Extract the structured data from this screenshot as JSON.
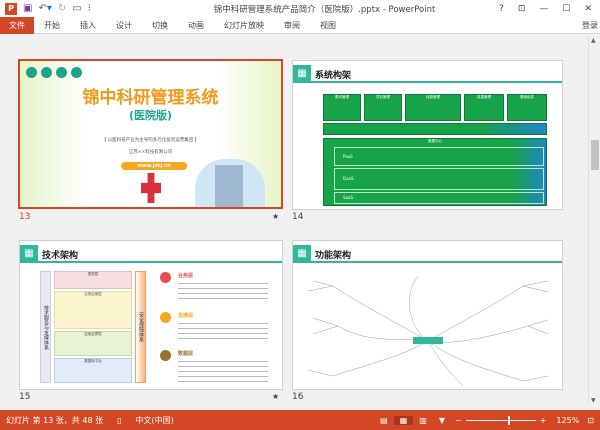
{
  "window": {
    "title": "锦中科研管理系统产品简介（医院版）.pptx - PowerPoint",
    "help": "?",
    "restore_ribbon": "⊡",
    "minimize": "—",
    "maximize": "☐",
    "close": "✕"
  },
  "quick_access": {
    "app_icon": "P",
    "save_icon": "save-icon",
    "undo_icon": "undo-icon",
    "redo_icon": "redo-icon",
    "present_icon": "present-icon"
  },
  "ribbon": {
    "tabs": [
      "文件",
      "开始",
      "插入",
      "设计",
      "切换",
      "动画",
      "幻灯片放映",
      "审阅",
      "视图"
    ],
    "login": "登录"
  },
  "slides": [
    {
      "number": "13",
      "selected": true,
      "star": "★",
      "title": "锦中科研管理系统",
      "subtitle": "(医院版)",
      "slogan": "【 以医科技产业为主导的多元化投资运营集团 】",
      "company": "江苏××科技有限公司",
      "url": "www.jzkj.cn"
    },
    {
      "number": "14",
      "title": "系统构架",
      "top_modules": [
        "基本管理",
        "项目管理",
        "经费管理",
        "成果管理",
        "基础信息"
      ],
      "center": "数据中心",
      "layers": [
        "PaaS",
        "DaaS",
        "SaaS"
      ]
    },
    {
      "number": "15",
      "star": "★",
      "title": "技术架构",
      "left_label": "技术服务与支撑体系",
      "right_label": "安全保障体系",
      "layers": [
        "表现层",
        "业务应用层",
        "应用支撑层",
        "数据库平台"
      ],
      "sections": [
        {
          "label": "业务层",
          "color": "#e84c4c"
        },
        {
          "label": "支撑层",
          "color": "#f5a623"
        },
        {
          "label": "数据层",
          "color": "#9a7230"
        }
      ]
    },
    {
      "number": "16",
      "title": "功能架构"
    }
  ],
  "status": {
    "slide_info": "幻灯片 第 13 张，共 48 张",
    "language": "中文(中国)",
    "zoom": "125%",
    "zoom_level_percent": 125
  },
  "colors": {
    "accent": "#d24726",
    "teal": "#2fb89a",
    "green": "#17a34a"
  }
}
